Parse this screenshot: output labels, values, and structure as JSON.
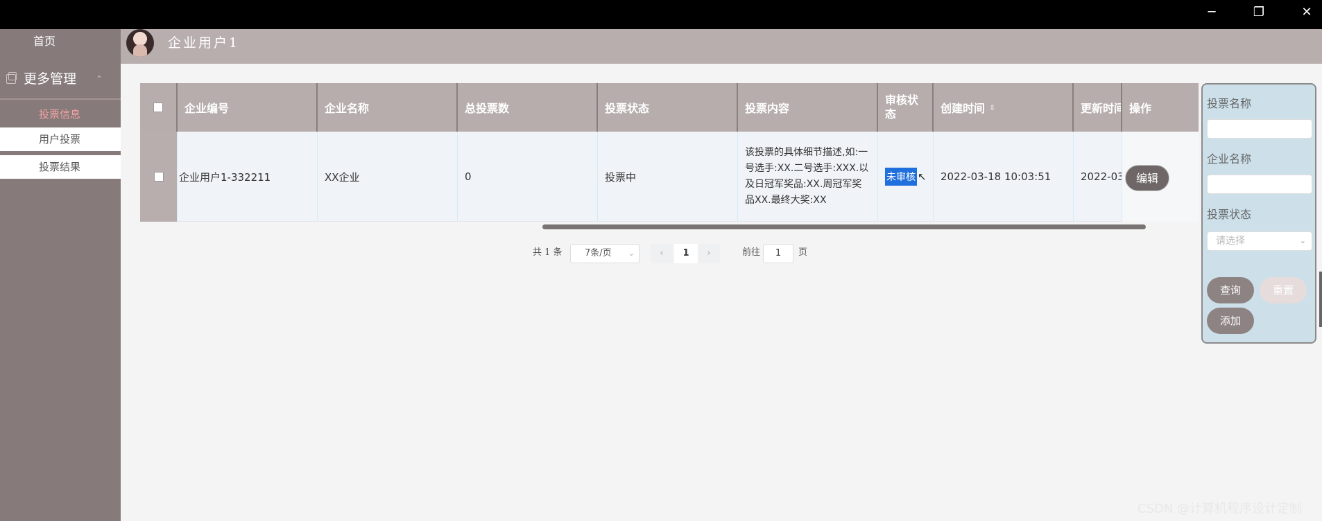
{
  "window": {
    "minimize": "─",
    "restore": "❐",
    "close": "✕"
  },
  "sidebar": {
    "home": "首页",
    "group": {
      "label": "更多管理",
      "chevron": "⌃"
    },
    "items": [
      {
        "label": "投票信息"
      },
      {
        "label": "用户投票"
      },
      {
        "label": "投票结果"
      }
    ]
  },
  "header": {
    "title": "企业用户1"
  },
  "table": {
    "columns": [
      "企业编号",
      "企业名称",
      "总投票数",
      "投票状态",
      "投票内容",
      "审核状态",
      "创建时间",
      "更新时间",
      "操作"
    ],
    "sort_icon": "⇕",
    "rows": [
      {
        "code": "企业用户1-332211",
        "name": "XX企业",
        "total": "0",
        "status": "投票中",
        "content": "该投票的具体细节描述,如:一号选手:XX.二号选手:XXX.以及日冠军奖品:XX.周冠军奖品XX.最终大奖:XX",
        "review": "未审核",
        "created": "2022-03-18 10:03:51",
        "updated": "2022-03",
        "edit": "编辑"
      }
    ]
  },
  "pagination": {
    "total": "共 1 条",
    "page_size": "7条/页",
    "prev": "‹",
    "current": "1",
    "next": "›",
    "goto": "前往",
    "goto_value": "1",
    "page_suffix": "页"
  },
  "search": {
    "vote_name_label": "投票名称",
    "company_name_label": "企业名称",
    "vote_status_label": "投票状态",
    "vote_status_placeholder": "请选择",
    "query": "查询",
    "reset": "重置",
    "add": "添加"
  },
  "watermark": "CSDN @计算机程序设计定制",
  "colors": {
    "sidebar": "#867a7b",
    "header": "#b8aeae",
    "search_panel": "#cde0ea",
    "badge": "#1f6fdd"
  }
}
